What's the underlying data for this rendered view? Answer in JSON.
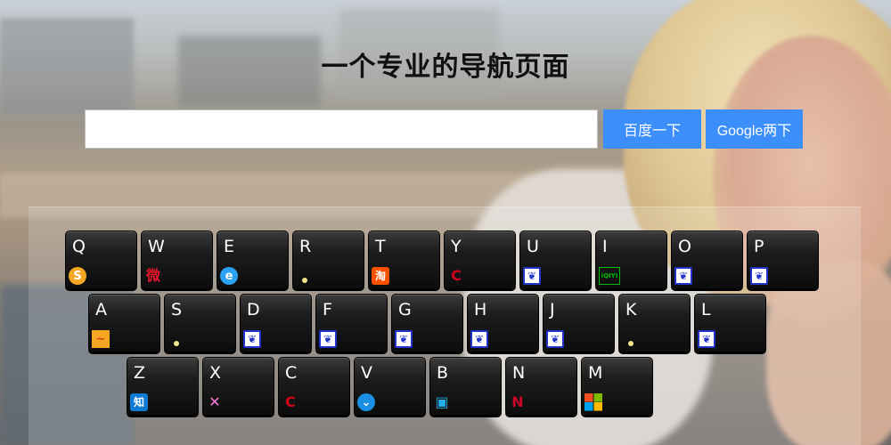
{
  "page": {
    "title": "一个专业的导航页面"
  },
  "search": {
    "value": "",
    "placeholder": "",
    "baidu_label": "百度一下",
    "google_label": "Google两下"
  },
  "keyboard": {
    "row1": [
      {
        "letter": "Q",
        "icon": "sogou-icon",
        "glyph": "S",
        "color": "#f5a623"
      },
      {
        "letter": "W",
        "icon": "weibo-icon",
        "glyph": "微",
        "color": "#e6162d"
      },
      {
        "letter": "E",
        "icon": "browser-e-icon",
        "glyph": "e",
        "color": "#2aa1f2"
      },
      {
        "letter": "R",
        "icon": "dot-icon",
        "glyph": "",
        "color": "#f6e48a"
      },
      {
        "letter": "T",
        "icon": "taobao-icon",
        "glyph": "淘",
        "color": "#ff5000"
      },
      {
        "letter": "Y",
        "icon": "c-logo-icon",
        "glyph": "C",
        "color": "#d6001c"
      },
      {
        "letter": "U",
        "icon": "baidu-paw-icon",
        "glyph": "",
        "color": "#2233cc"
      },
      {
        "letter": "I",
        "icon": "iqiyi-icon",
        "glyph": "iQIYI",
        "color": "#00be06"
      },
      {
        "letter": "O",
        "icon": "baidu-paw-icon",
        "glyph": "",
        "color": "#2233cc"
      },
      {
        "letter": "P",
        "icon": "baidu-paw-icon",
        "glyph": "",
        "color": "#2233cc"
      }
    ],
    "row2": [
      {
        "letter": "A",
        "icon": "chart-app-icon",
        "glyph": "~",
        "color": "#f5a623"
      },
      {
        "letter": "S",
        "icon": "dot-icon",
        "glyph": "",
        "color": "#f6e48a"
      },
      {
        "letter": "D",
        "icon": "baidu-paw-icon",
        "glyph": "",
        "color": "#2233cc"
      },
      {
        "letter": "F",
        "icon": "baidu-paw-icon",
        "glyph": "",
        "color": "#2233cc"
      },
      {
        "letter": "G",
        "icon": "baidu-paw-icon",
        "glyph": "",
        "color": "#2233cc"
      },
      {
        "letter": "H",
        "icon": "baidu-paw-icon",
        "glyph": "",
        "color": "#2233cc"
      },
      {
        "letter": "J",
        "icon": "baidu-paw-icon",
        "glyph": "",
        "color": "#2233cc"
      },
      {
        "letter": "K",
        "icon": "dot-icon",
        "glyph": "",
        "color": "#f6e48a"
      },
      {
        "letter": "L",
        "icon": "baidu-paw-icon",
        "glyph": "",
        "color": "#2233cc"
      }
    ],
    "row3": [
      {
        "letter": "Z",
        "icon": "zhihu-icon",
        "glyph": "知",
        "color": "#0e7ad5"
      },
      {
        "letter": "X",
        "icon": "x-logo-icon",
        "glyph": "✕",
        "color": "#ff7ad9"
      },
      {
        "letter": "C",
        "icon": "c-logo-icon",
        "glyph": "C",
        "color": "#d6001c"
      },
      {
        "letter": "V",
        "icon": "chevron-circle-icon",
        "glyph": "⌄",
        "color": "#1a8fe3"
      },
      {
        "letter": "B",
        "icon": "bilibili-icon",
        "glyph": "▣",
        "color": "#23ade5"
      },
      {
        "letter": "N",
        "icon": "nba-icon",
        "glyph": "N",
        "color": "#c9082a"
      },
      {
        "letter": "M",
        "icon": "microsoft-icon",
        "glyph": "",
        "color": "#f25022"
      }
    ]
  }
}
